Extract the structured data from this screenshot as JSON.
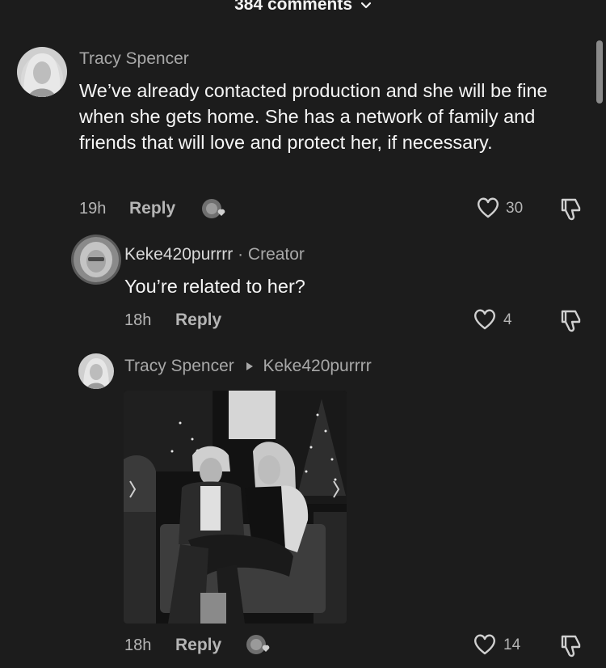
{
  "header": {
    "comments_label": "384 comments"
  },
  "comments": [
    {
      "username": "Tracy Spencer",
      "text": "We’ve already contacted production and she will be fine when she gets home. She has a network of family and friends that will love and protect her, if necessary.",
      "time": "19h",
      "reply_label": "Reply",
      "likes": "30"
    },
    {
      "username": "Keke420purrrr",
      "creator_tag": "· Creator",
      "text": "You’re related to her?",
      "time": "18h",
      "reply_label": "Reply",
      "likes": "4"
    },
    {
      "username": "Tracy Spencer",
      "reply_to": "Keke420purrrr",
      "time": "18h",
      "reply_label": "Reply",
      "likes": "14"
    }
  ],
  "icons": {
    "chevron": "chevron-down-icon",
    "like": "heart-icon",
    "dislike": "thumbs-down-icon",
    "react": "emoji-react-icon"
  },
  "colors": {
    "background": "#1c1c1c",
    "text": "#ffffff",
    "muted": "#b5b5b5"
  }
}
